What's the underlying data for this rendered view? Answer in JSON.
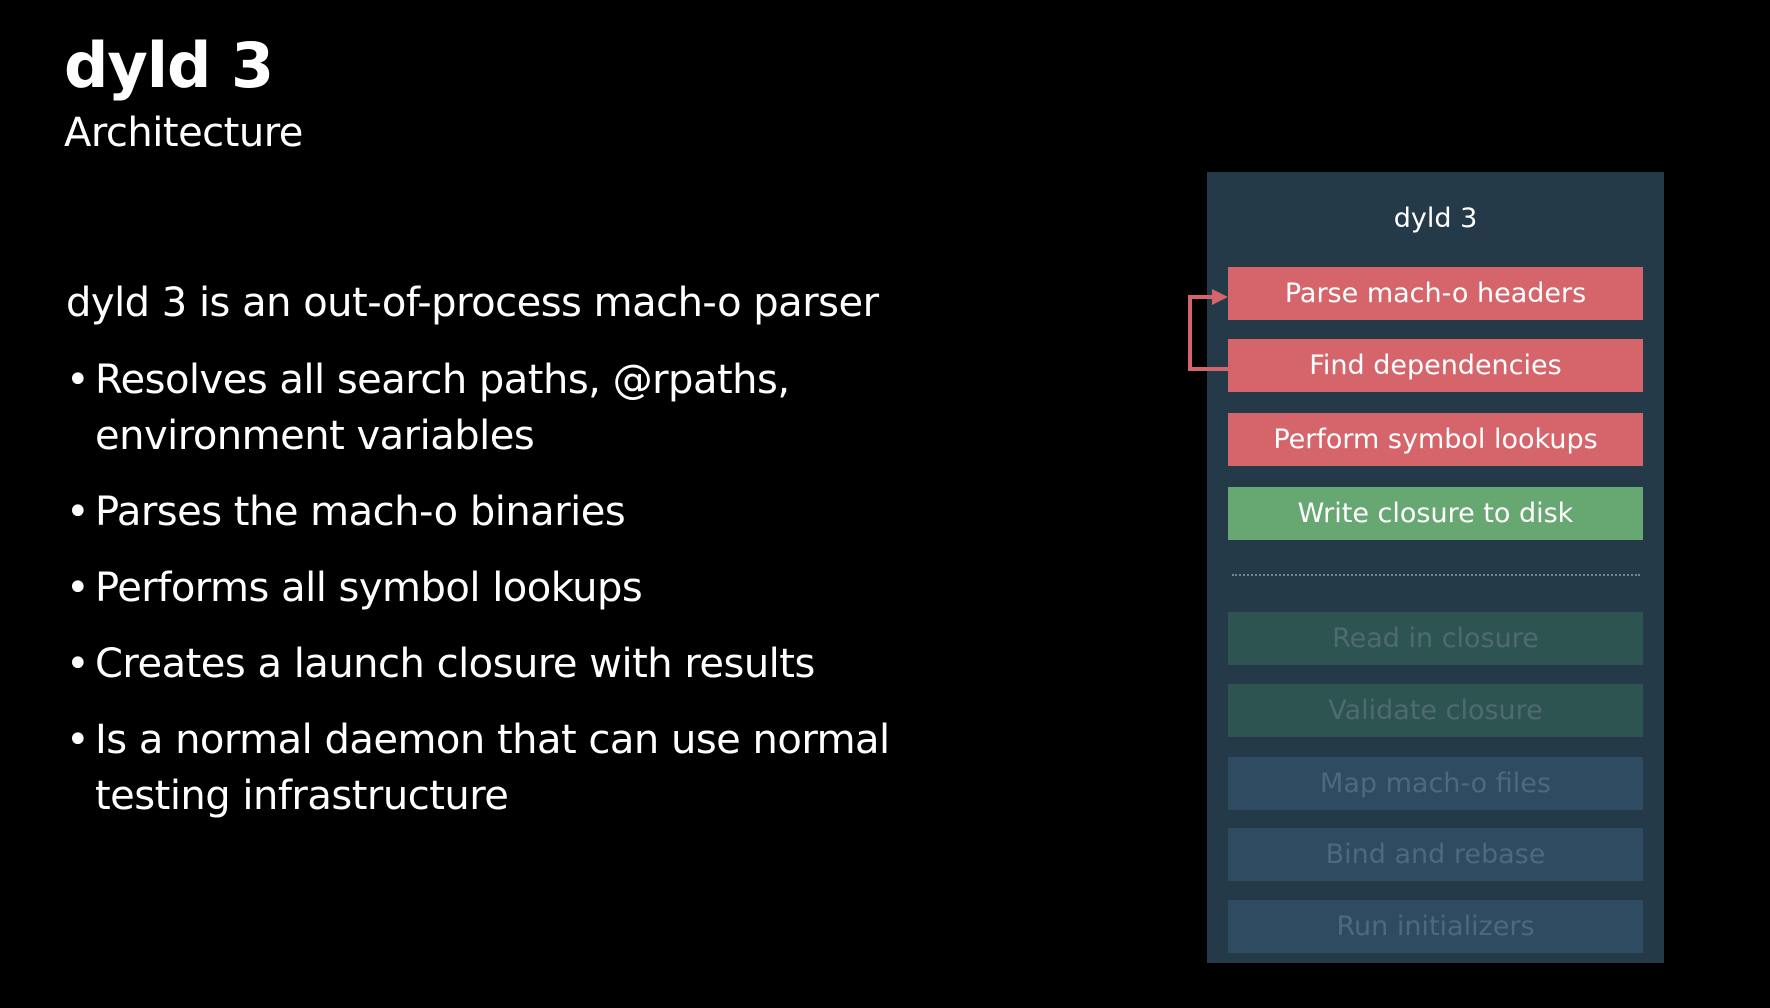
{
  "slide": {
    "title": "dyld 3",
    "subtitle": "Architecture",
    "lead": "dyld 3 is an out-of-process mach-o parser",
    "bullet_symbol": "•",
    "bullets": [
      "Resolves all search paths, @rpaths,\nenvironment variables",
      "Parses the mach-o binaries",
      "Performs all symbol lookups",
      "Creates a launch closure with results",
      "Is a normal daemon that can use normal\ntesting infrastructure"
    ]
  },
  "diagram": {
    "title": "dyld 3",
    "steps": [
      "Parse mach-o headers",
      "Find dependencies",
      "Perform symbol lookups",
      "Write closure to disk",
      "Read in closure",
      "Validate closure",
      "Map mach-o files",
      "Bind and rebase",
      "Run initializers"
    ]
  },
  "colors": {
    "background": "#000000",
    "panel": "#253a48",
    "active_red": "#d6656b",
    "active_green": "#67a872",
    "dim_green": "#2e5451",
    "dim_blue": "#2e4b62",
    "arrow": "#d6656b"
  }
}
